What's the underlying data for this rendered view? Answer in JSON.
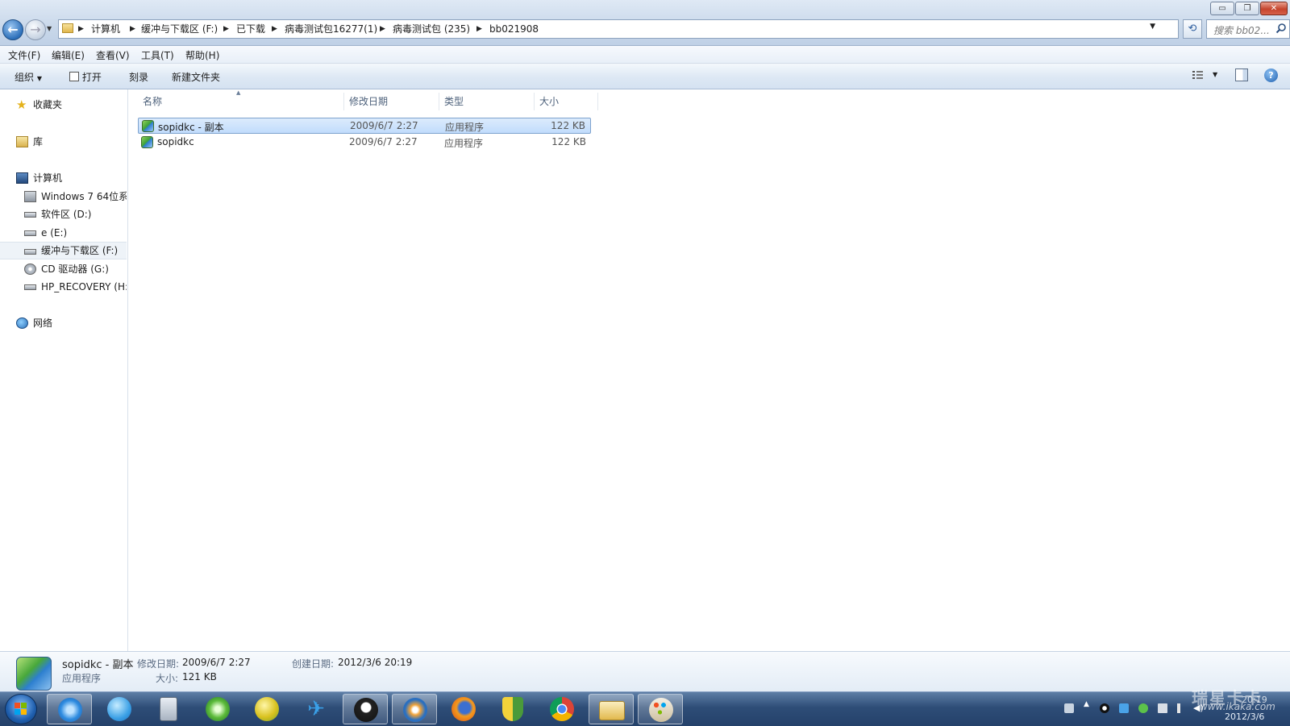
{
  "window": {
    "minimize": "▭",
    "restore": "❐",
    "close": "✕"
  },
  "address": {
    "crumbs": [
      "计算机",
      "缓冲与下载区 (F:)",
      "已下载",
      "病毒测试包16277(1)",
      "病毒测试包 (235)",
      "bb021908"
    ],
    "search_placeholder": "搜索 bb02..."
  },
  "menu": [
    "文件(F)",
    "编辑(E)",
    "查看(V)",
    "工具(T)",
    "帮助(H)"
  ],
  "toolbar": {
    "organize": "组织",
    "open": "打开",
    "burn": "刻录",
    "new_folder": "新建文件夹"
  },
  "sidebar": {
    "favorites": "收藏夹",
    "libraries": "库",
    "computer": "计算机",
    "drives": [
      "Windows 7 64位系",
      "软件区 (D:)",
      "e (E:)",
      "缓冲与下载区 (F:)",
      "CD 驱动器 (G:)",
      "HP_RECOVERY (H:)"
    ],
    "network": "网络"
  },
  "columns": {
    "name": "名称",
    "modified": "修改日期",
    "type": "类型",
    "size": "大小"
  },
  "files": [
    {
      "name": "sopidkc - 副本",
      "modified": "2009/6/7 2:27",
      "type": "应用程序",
      "size": "122 KB"
    },
    {
      "name": "sopidkc",
      "modified": "2009/6/7 2:27",
      "type": "应用程序",
      "size": "122 KB"
    }
  ],
  "details": {
    "name": "sopidkc - 副本",
    "type": "应用程序",
    "modified_label": "修改日期:",
    "modified": "2009/6/7 2:27",
    "size_label": "大小:",
    "size": "121 KB",
    "created_label": "创建日期:",
    "created": "2012/3/6 20:19"
  },
  "taskbar": {
    "apps": [
      "internet-explorer",
      "qq-browser",
      "calculator",
      "refresh-tool",
      "360-icon",
      "bird-icon",
      "qq-penguin",
      "media-player",
      "firefox",
      "shield-security",
      "chrome",
      "file-explorer",
      "paint"
    ],
    "watermark": "瑞星卡卡",
    "watermark_url": "www.ikaka.com",
    "clock_time": "20:19",
    "clock_date": "2012/3/6"
  },
  "colors": {
    "selection": "#c1dcfc",
    "taskbar": "#2e4d77",
    "accent": "#2c6fb9"
  }
}
